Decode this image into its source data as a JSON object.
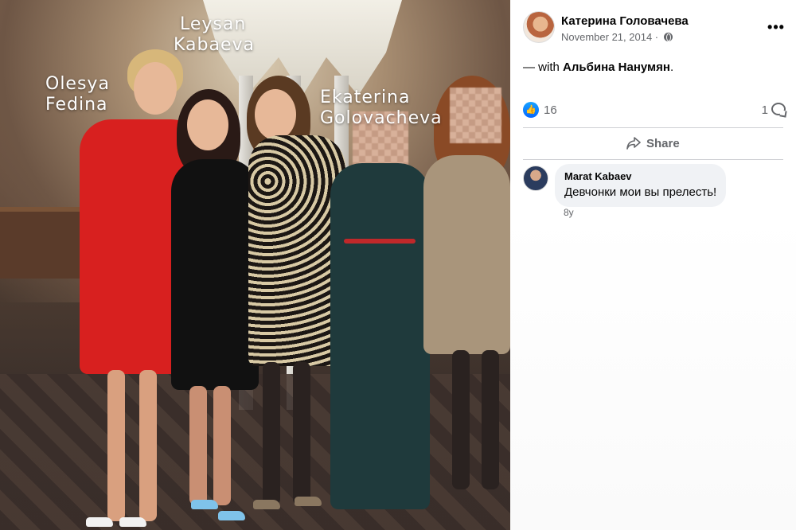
{
  "photo": {
    "labels": [
      {
        "line1": "Olesya",
        "line2": "Fedina"
      },
      {
        "line1": "Leysan",
        "line2": "Kabaeva"
      },
      {
        "line1": "Ekaterina",
        "line2": "Golovacheva"
      }
    ]
  },
  "post": {
    "author": "Катерина Головачева",
    "date": "November 21, 2014",
    "separator": " · ",
    "with_prefix": "— with ",
    "with_name": "Альбина Нанумян",
    "with_suffix": ".",
    "likes": "16",
    "comments_count": "1",
    "share_label": "Share",
    "more_label": "•••",
    "like_glyph": "👍"
  },
  "comment": {
    "author": "Marat Kabaev",
    "text": "Девчонки мои вы прелесть!",
    "age": "8y"
  },
  "colors": {
    "meta_grey": "#65676b",
    "bubble_bg": "#f0f2f5",
    "like_blue": "#0566ff"
  }
}
